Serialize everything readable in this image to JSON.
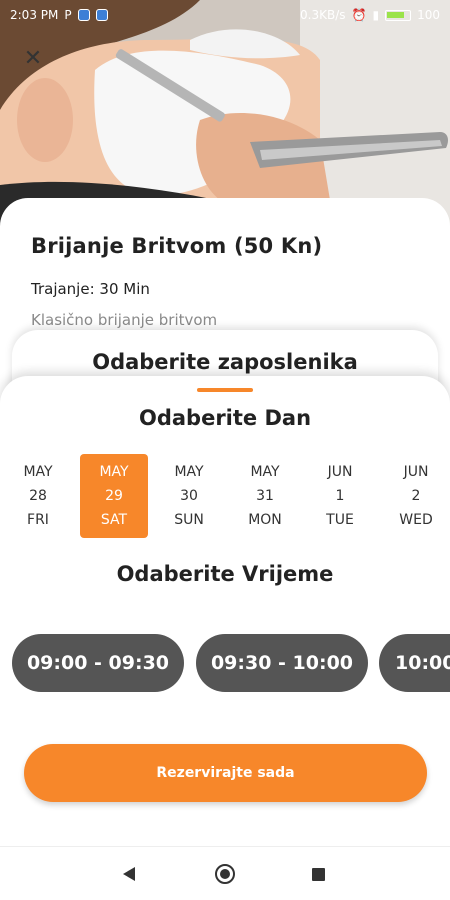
{
  "status_bar": {
    "time": "2:03 PM",
    "carrier_letter": "P",
    "network_speed": "0.3KB/s",
    "battery_text": "100"
  },
  "service": {
    "title": "Brijanje Britvom (50 Kn)",
    "duration": "Trajanje: 30 Min",
    "description": "Klasično brijanje britvom"
  },
  "employee": {
    "title": "Odaberite zaposlenika"
  },
  "booking": {
    "day_title": "Odaberite Dan",
    "days": [
      {
        "month": "MAY",
        "date": "28",
        "weekday": "FRI",
        "selected": false
      },
      {
        "month": "MAY",
        "date": "29",
        "weekday": "SAT",
        "selected": true
      },
      {
        "month": "MAY",
        "date": "30",
        "weekday": "SUN",
        "selected": false
      },
      {
        "month": "MAY",
        "date": "31",
        "weekday": "MON",
        "selected": false
      },
      {
        "month": "JUN",
        "date": "1",
        "weekday": "TUE",
        "selected": false
      },
      {
        "month": "JUN",
        "date": "2",
        "weekday": "WED",
        "selected": false
      }
    ],
    "time_title": "Odaberite Vrijeme",
    "time_slots": [
      "09:00 - 09:30",
      "09:30 - 10:00",
      "10:00"
    ],
    "reserve_label": "Rezervirajte sada"
  },
  "colors": {
    "accent": "#f7872a",
    "slot_background": "#555555"
  }
}
